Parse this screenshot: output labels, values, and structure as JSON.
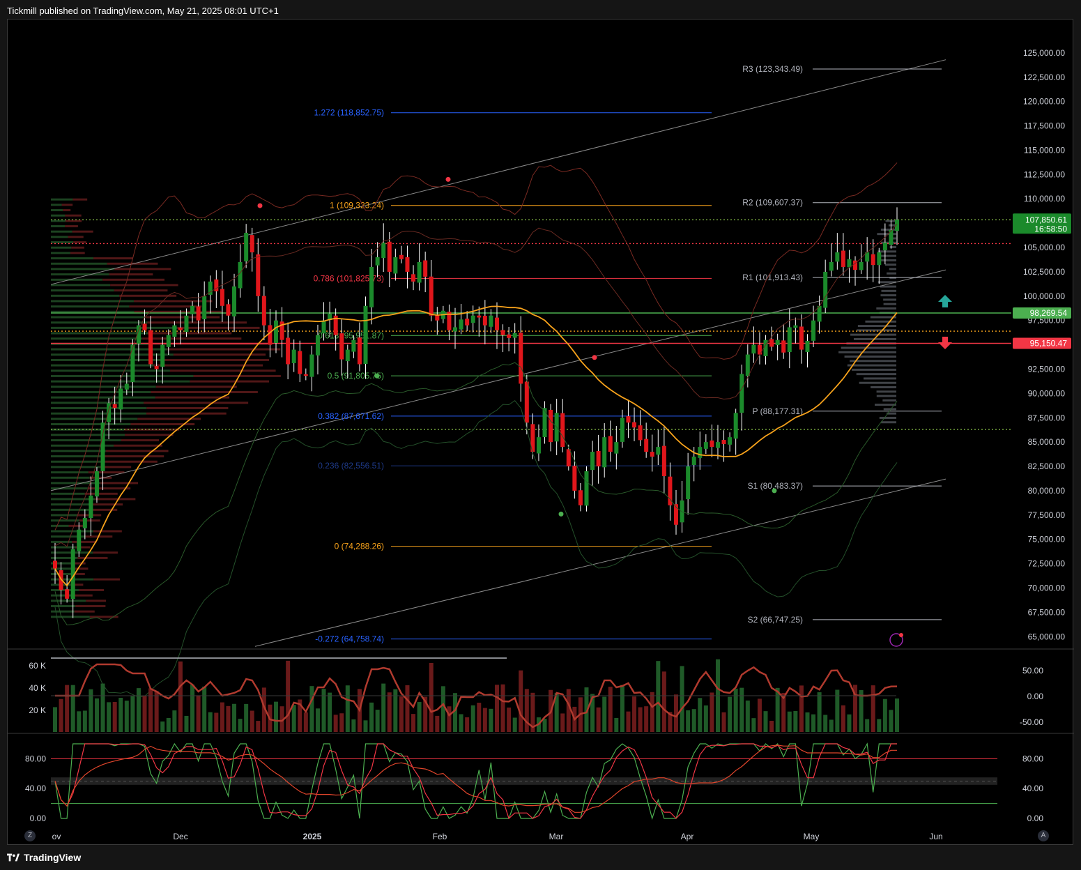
{
  "header": {
    "text": "Tickmill published on TradingView.com, May 21, 2025 08:01 UTC+1"
  },
  "footer": {
    "brand": "TradingView"
  },
  "buttons": {
    "zoom_label": "Z",
    "auto_label": "A"
  },
  "colors": {
    "up": "#1b8a2b",
    "down": "#e0161b",
    "ma": "#f7a21b",
    "fib_orange": "#f7a21b",
    "fib_blue": "#2962ff",
    "fib_red": "#f23645",
    "green_line": "#4caf50",
    "red_line": "#f23645"
  },
  "chart_data": [
    {
      "type": "candlestick",
      "symbol_price_label": "107,850.61",
      "countdown_label": "16:58:50",
      "green_level_label": "98,269.54",
      "red_level_label": "95,150.47",
      "ylim": [
        63800,
        127000
      ],
      "y_ticks": [
        "125,000.00",
        "122,500.00",
        "120,000.00",
        "117,500.00",
        "115,000.00",
        "112,500.00",
        "110,000.00",
        "107,500.00",
        "105,000.00",
        "102,500.00",
        "100,000.00",
        "97,500.00",
        "92,500.00",
        "90,000.00",
        "87,500.00",
        "85,000.00",
        "82,500.00",
        "80,000.00",
        "77,500.00",
        "75,000.00",
        "72,500.00",
        "70,000.00",
        "67,500.00",
        "65,000.00"
      ],
      "y_tick_values": [
        125000,
        122500,
        120000,
        117500,
        115000,
        112500,
        110000,
        107500,
        105000,
        102500,
        100000,
        97500,
        92500,
        90000,
        87500,
        85000,
        82500,
        80000,
        77500,
        75000,
        72500,
        70000,
        67500,
        65000
      ],
      "x_ticks": [
        "Nov",
        "Dec",
        "2025",
        "Feb",
        "Mar",
        "Apr",
        "May",
        "Jun"
      ],
      "fib_levels": [
        {
          "label": "1.272 (118,852.75)",
          "value": 118852.75,
          "color": "#2962ff"
        },
        {
          "label": "1 (109,323.24)",
          "value": 109323.24,
          "color": "#f7a21b"
        },
        {
          "label": "0.786 (101,825.73)",
          "value": 101825.73,
          "color": "#f23645"
        },
        {
          "label": "0.618 (95,951.87)",
          "value": 95951.87,
          "color": "#4caf50"
        },
        {
          "label": "0.5 (91,805.75)",
          "value": 91805.75,
          "color": "#4caf50"
        },
        {
          "label": "0.382 (87,671.62)",
          "value": 87671.62,
          "color": "#2962ff"
        },
        {
          "label": "0.236 (82,556.51)",
          "value": 82556.51,
          "color": "#1e3a8a"
        },
        {
          "label": "0 (74,288.26)",
          "value": 74288.26,
          "color": "#f7a21b"
        },
        {
          "label": "-0.272 (64,758.74)",
          "value": 64758.74,
          "color": "#2962ff"
        }
      ],
      "pivots": [
        {
          "label": "R3 (123,343.49)",
          "value": 123343.49
        },
        {
          "label": "R2 (109,607.37)",
          "value": 109607.37
        },
        {
          "label": "R1 (101,913.43)",
          "value": 101913.43
        },
        {
          "label": "P (88,177.31)",
          "value": 88177.31
        },
        {
          "label": "S1 (80,483.37)",
          "value": 80483.37
        },
        {
          "label": "S2 (66,747.25)",
          "value": 66747.25
        }
      ],
      "horizontal_levels": [
        {
          "value": 98269.54,
          "color": "#4caf50",
          "style": "solid"
        },
        {
          "value": 95150.47,
          "color": "#f23645",
          "style": "solid"
        },
        {
          "value": 105400,
          "color": "#f23645",
          "style": "dotted"
        },
        {
          "value": 96400,
          "color": "#f7a21b",
          "style": "dotted"
        },
        {
          "value": 86300,
          "color": "#8bc34a",
          "style": "dotted"
        },
        {
          "value": 107850,
          "color": "#8bc34a",
          "style": "dotted"
        }
      ],
      "closes": [
        72000,
        69800,
        68900,
        74000,
        76000,
        77200,
        79500,
        82000,
        87000,
        89000,
        88500,
        90500,
        91000,
        95000,
        97000,
        96500,
        93000,
        92500,
        95000,
        96000,
        97000,
        96500,
        98000,
        99000,
        97500,
        100000,
        101500,
        100500,
        99000,
        98000,
        101000,
        103500,
        106500,
        104500,
        100000,
        97000,
        95000,
        97500,
        95500,
        93000,
        94500,
        92000,
        91800,
        94000,
        96000,
        97500,
        98200,
        96000,
        93500,
        94500,
        95500,
        93000,
        99000,
        103000,
        104000,
        105500,
        102500,
        104000,
        103800,
        102500,
        101500,
        103500,
        102000,
        98000,
        97500,
        98500,
        96500,
        96800,
        97600,
        97000,
        98000,
        97800,
        97000,
        98000,
        96500,
        96000,
        95700,
        96200,
        91000,
        87000,
        84000,
        85500,
        88500,
        85000,
        88000,
        84500,
        82500,
        80000,
        78500,
        82000,
        84000,
        82500,
        85500,
        84000,
        85000,
        87500,
        87000,
        86500,
        85200,
        84000,
        83500,
        84500,
        81500,
        78500,
        76500,
        79000,
        82500,
        83500,
        84500,
        85000,
        84500,
        85000,
        84800,
        85500,
        88000,
        92000,
        94000,
        95000,
        94000,
        95500,
        94800,
        95500,
        94200,
        96800,
        97000,
        94500,
        95400,
        97500,
        99000,
        102500,
        103500,
        104500,
        103000,
        103800,
        102700,
        103500,
        104500,
        103200,
        104500,
        105500,
        106800,
        107850
      ]
    },
    {
      "type": "bar+line",
      "name": "volume / oscillator panel",
      "y_ticks_left": [
        "60 K",
        "40 K",
        "20 K"
      ],
      "y_ticks_right": [
        "50.00",
        "0.00",
        "-50.00"
      ]
    },
    {
      "type": "line",
      "name": "stochastic panel",
      "y_ticks_left": [
        "80.00",
        "40.00",
        "0.00"
      ],
      "y_ticks_right": [
        "80.00",
        "40.00",
        "0.00"
      ],
      "bands": [
        80,
        20
      ]
    }
  ]
}
